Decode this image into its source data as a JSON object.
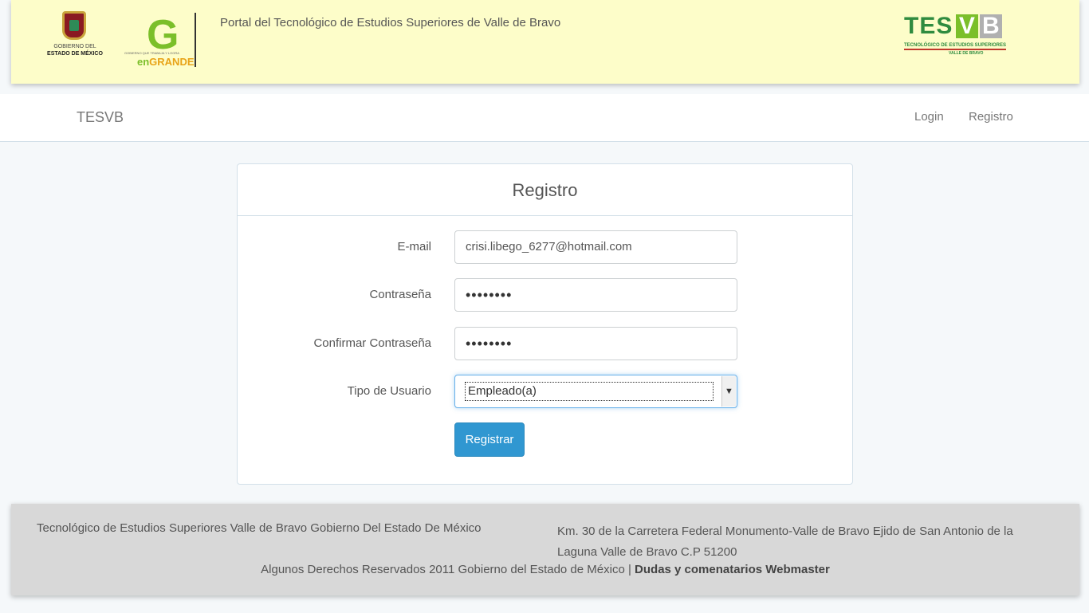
{
  "header": {
    "portal_title": "Portal del Tecnológico de Estudios Superiores de Valle de Bravo",
    "gob_logo_line1": "GOBIERNO DEL",
    "gob_logo_line2": "ESTADO DE MÉXICO",
    "engrande_tiny": "GOBIERNO QUE TRABAJA Y LOGRA",
    "engrande_en": "en",
    "engrande_grande": "GRANDE",
    "tesvb_logo_tes": "TES",
    "tesvb_logo_v": "V",
    "tesvb_logo_b": "B",
    "tesvb_logo_sub1": "TECNOLÓGICO DE ESTUDIOS SUPERIORES",
    "tesvb_logo_sub2": "VALLE DE BRAVO"
  },
  "navbar": {
    "brand": "TESVB",
    "links": [
      "Login",
      "Registro"
    ]
  },
  "form": {
    "title": "Registro",
    "email_label": "E-mail",
    "email_value": "crisi.libego_6277@hotmail.com",
    "password_label": "Contraseña",
    "password_value": "••••••••",
    "confirm_label": "Confirmar Contraseña",
    "confirm_value": "••••••••",
    "user_type_label": "Tipo de Usuario",
    "user_type_value": "Empleado(a)",
    "submit_label": "Registrar"
  },
  "footer": {
    "left_text": "Tecnológico de Estudios Superiores Valle de Bravo Gobierno Del Estado De México",
    "right_text": "Km. 30 de la Carretera Federal Monumento-Valle de Bravo Ejido de San Antonio de la Laguna Valle de Bravo C.P 51200",
    "rights_text": "Algunos Derechos Reservados 2011 Gobierno del Estado de México | ",
    "webmaster_link": "Dudas y comenatarios Webmaster"
  },
  "colors": {
    "banner_bg": "#fdfdc9",
    "primary_button": "#3097d1",
    "footer_bg": "#d8d8d8",
    "page_bg": "#f5f8fa"
  }
}
